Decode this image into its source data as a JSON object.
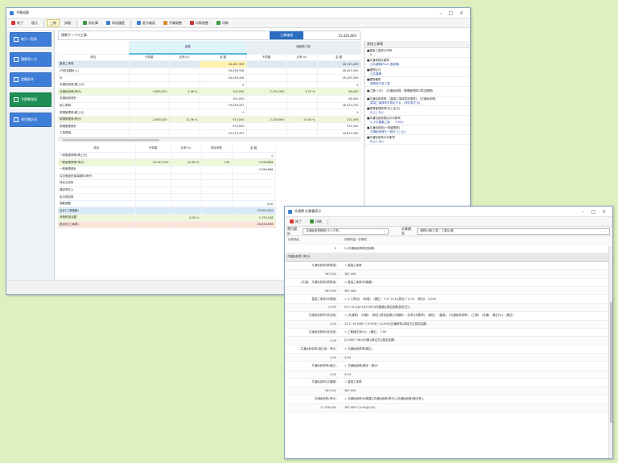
{
  "colors": {
    "background": "#dff0c0",
    "accent_blue": "#2a6cc0",
    "selected_yellow": "#fff3b0",
    "sidebar_green": "#1f8f55",
    "sidebar_blue": "#3f7ed8"
  },
  "main_window": {
    "title": "予算組算",
    "toolbar": [
      {
        "label": "終了",
        "icon": "close-icon",
        "color": "#d33"
      },
      {
        "label": "復元",
        "icon": "",
        "color": ""
      },
      {
        "label": "三期",
        "icon": "",
        "color": "",
        "active": true
      },
      {
        "label": "詳細",
        "icon": "",
        "color": ""
      },
      {
        "label": "再計算",
        "icon": "recalc-icon",
        "color": "#3a9a3a"
      },
      {
        "label": "承認履歴",
        "icon": "history-icon",
        "color": "#3a7fd0"
      },
      {
        "label": "差分確認",
        "icon": "diff-icon",
        "color": "#3a7fd0"
      },
      {
        "label": "予算調整",
        "icon": "adjust-icon",
        "color": "#d88a2a"
      },
      {
        "label": "印刷調整",
        "icon": "print-setup-icon",
        "color": "#c33"
      },
      {
        "label": "印刷",
        "icon": "print-icon",
        "color": "#3a9a3a"
      }
    ],
    "sidebar": [
      {
        "label": "取引一覧表",
        "color": "#3f7ed8"
      },
      {
        "label": "積算表入力",
        "color": "#3f7ed8"
      },
      {
        "label": "設備条件",
        "color": "#3f7ed8"
      },
      {
        "label": "予算整理表",
        "color": "#1f8f55"
      },
      {
        "label": "項目集計別",
        "color": "#3f7ed8"
      }
    ],
    "name_bar": {
      "name": "建築サンプル工事",
      "label": "工事価格",
      "amount": "15,826,800"
    },
    "tabs": {
      "left": "金額",
      "right": "諸経費工事"
    },
    "upper_headers": [
      "費目",
      "予算額",
      "比率(%)",
      "金 額",
      "予算額",
      "比率(%)",
      "金 額"
    ],
    "upper_rows": [
      {
        "label": "直接工事費",
        "c1": "",
        "c2": "",
        "c3": "18,467,309",
        "c4": "",
        "c5": "",
        "c6": "28,345,450",
        "style": "highlight"
      },
      {
        "label": "(内訳金額計上)",
        "c1": "",
        "c2": "",
        "c3": "18,436,308",
        "c4": "",
        "c5": "",
        "c6": "28,455,300",
        "style": ""
      },
      {
        "label": "計",
        "c1": "",
        "c2": "",
        "c3": "18,436,308",
        "c4": "",
        "c5": "",
        "c6": "28,455,300",
        "style": ""
      },
      {
        "label": "共通仮設費(積上分)",
        "c1": "",
        "c2": "",
        "c3": "0",
        "c4": "",
        "c5": "",
        "c6": "0",
        "style": ""
      },
      {
        "label": "共通仮設費(率分)",
        "c1": "2,880,020",
        "c2": "3.46 %",
        "c3": "100,000",
        "c4": "2,294,900",
        "c5": "3.20 %",
        "c6": "68,400",
        "style": "green"
      },
      {
        "label": "共通仮設費計",
        "c1": "",
        "c2": "",
        "c3": "100,000",
        "c4": "",
        "c5": "",
        "c6": "68,400",
        "style": ""
      },
      {
        "label": "純工事費",
        "c1": "",
        "c2": "",
        "c3": "19,036,307",
        "c4": "",
        "c5": "",
        "c6": "28,523,700",
        "style": ""
      },
      {
        "label": "現場管理費(積上分)",
        "c1": "",
        "c2": "",
        "c3": "0",
        "c4": "",
        "c5": "",
        "c6": "0",
        "style": ""
      },
      {
        "label": "現場管理費(率分)",
        "c1": "2,980,020",
        "c2": "12.56 %",
        "c3": "374,000",
        "c4": "2,308,900",
        "c5": "10.00 %",
        "c6": "231,000",
        "style": "green"
      },
      {
        "label": "現場管理費計",
        "c1": "",
        "c2": "",
        "c3": "374,000",
        "c4": "",
        "c5": "",
        "c6": "231,000",
        "style": ""
      },
      {
        "label": "工事原価",
        "c1": "",
        "c2": "",
        "c3": "19,410,307",
        "c4": "",
        "c5": "",
        "c6": "28,615,300",
        "style": ""
      }
    ],
    "lower_headers": [
      "費目",
      "予算額",
      "比率(%)",
      "調定係数",
      "金 額"
    ],
    "lower_rows": [
      {
        "label": "一般管理費等(積上分)",
        "c1": "",
        "c2": "",
        "c3": "",
        "c4": "0",
        "style": ""
      },
      {
        "label": "一般管理費等(率分)",
        "c1": "34,445,520",
        "c2": "10.89 %",
        "c3": "1.00",
        "c4": "4,396,866",
        "style": "green"
      },
      {
        "label": "一般管理費計",
        "c1": "",
        "c2": "",
        "c3": "",
        "c4": "4,396,866",
        "style": ""
      },
      {
        "label": "住宅瑕疵担保保険料(県外)",
        "c1": "",
        "c2": "",
        "c3": "",
        "c4": "",
        "style": ""
      },
      {
        "label": "特定法定料",
        "c1": "",
        "c2": "",
        "c3": "",
        "c4": "",
        "style": ""
      },
      {
        "label": "建設発生土",
        "c1": "",
        "c2": "",
        "c3": "",
        "c4": "",
        "style": ""
      },
      {
        "label": "処分費加算",
        "c1": "",
        "c2": "",
        "c3": "",
        "c4": "",
        "style": ""
      },
      {
        "label": "端数調整",
        "c1": "",
        "c2": "",
        "c3": "",
        "c4": "0.00",
        "style": ""
      },
      {
        "label": "合計(工事価格)",
        "c1": "",
        "c2": "",
        "c3": "",
        "c4": "23,804,500",
        "style": "blue"
      },
      {
        "label": "消費税相当額",
        "c1": "",
        "c2": "8.00 %",
        "c3": "",
        "c4": "2,793,438",
        "style": "green"
      },
      {
        "label": "総合計(工事費)",
        "c1": "",
        "c2": "",
        "c3": "",
        "c4": "26,928,636",
        "style": "pink"
      }
    ],
    "right_panel": {
      "header": "直接工事費",
      "sections": [
        {
          "heading": "■直接工事費の内訳",
          "value": "0"
        },
        {
          "heading": "■共通費算定基準",
          "value": "公共建築(RC/S 造新築)"
        },
        {
          "heading": "■建物区分",
          "value": "公共建築"
        },
        {
          "heading": "■建物種別",
          "value": "事務所庁舎工事"
        },
        {
          "heading": "■工期(ヶ月)　(共通仮設費・現場管理費の算定期間)",
          "value": ""
        },
        {
          "heading": "■共通仮設費率　(直接工事費算定基準)　(共通仮設率)",
          "value": "直接工事費率を算出する　(率計算する)"
        },
        {
          "heading": "■現場管理費率(計上区分)",
          "value": "計上しない"
        },
        {
          "heading": "■共通仮設費算出の対象率",
          "value": "以下の建築工事　　0.001"
        },
        {
          "heading": "■共通仮設費(一般管理費)",
          "value": "共通仮設費を一般計上しない"
        },
        {
          "heading": "■共通仮設費の対象率",
          "value": "計上しない"
        }
      ]
    }
  },
  "preview_window": {
    "title": "共通費 計算書表示",
    "toolbar": [
      {
        "label": "終了",
        "icon": "close-icon",
        "color": "#d33"
      },
      {
        "label": "印刷",
        "icon": "print-icon",
        "color": "#3a9a3a"
      }
    ],
    "filter_label": "費目選択",
    "filter_value": "共通仮設費積算(ランク別)",
    "sort_label": "計算順序",
    "sort_value": "積算の順(工事・工事名)順",
    "col_heads": {
      "left": "計算項目",
      "right": "計算内容・計算式"
    },
    "first_row": {
      "key": "0",
      "value": "0 (共通仮設費算定結果)"
    },
    "section": "共通仮設費 (率分)",
    "rows": [
      {
        "key": "共通仮設費(積算値)",
        "value": "= 直接工事費"
      },
      {
        "key": "387,000",
        "value": "387,000"
      },
      {
        "key": "(共通)　共通仮設費(積算値)",
        "value": "= 直接工事費(対象額)"
      },
      {
        "key": "387,000",
        "value": "387,000"
      },
      {
        "key": "直接工事費(対象額)",
        "value": "= 4.7(算出)　(地域)　(補正)　5.0^(4.4)(算出)^(1.0)　(算出)　5,000"
      },
      {
        "key": "5,000",
        "value": "5.0^(4.4)(0.5)(5,000)(対象額)(算定結果(算定式))"
      },
      {
        "key": "共通仮設費率(算定値)",
        "value": "= (共通費)　(対象)　(算定)(算定結果)(共通費)　(比率)(対象率)　(補正)　(直接)　(共通仮設費率)　(工期)　(共通)　補正(%)　(補正)"
      },
      {
        "key": "4.40",
        "value": "12.1^(0.458)^(-0.503)^(4.200)(共通費率)(算定式)(算定結果)"
      },
      {
        "key": "共通仮設費率(算定値)",
        "value": "= 工期補正率(%)　(補正)　7.00"
      },
      {
        "key": "4.40",
        "value": "(0.458)^(60)(対象)(算定式)(算定結果)"
      },
      {
        "key": "共通仮設費率(補正値・率分)",
        "value": "= 共通仮設費率(補正)"
      },
      {
        "key": "4.40",
        "value": "4.40"
      },
      {
        "key": "共通仮設費率(補正)",
        "value": "= 共通仮設費(補正・積分)"
      },
      {
        "key": "4.40",
        "value": "4.40"
      },
      {
        "key": "共通仮設費(共通額)",
        "value": "= 直接工事費"
      },
      {
        "key": "387,000",
        "value": "387,000"
      },
      {
        "key": "共通仮設費(率分)",
        "value": "= 共通仮設費(対象額)(共通仮設費(率分))(共通仮設費(補正率))"
      },
      {
        "key": "17,028,000",
        "value": "387,000^(4.40)(0.01)"
      }
    ]
  }
}
